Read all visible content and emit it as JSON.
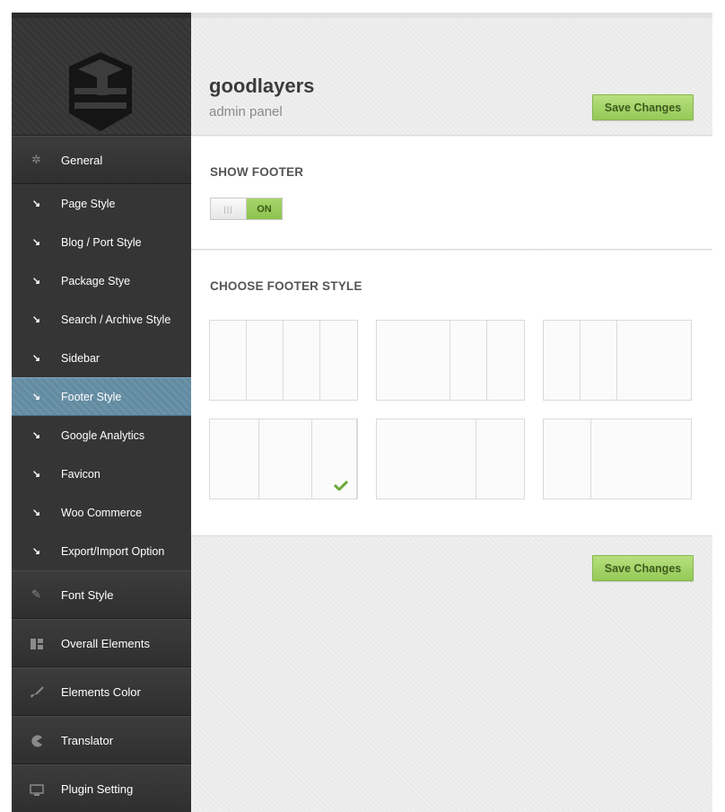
{
  "app": {
    "title": "goodlayers",
    "subtitle": "admin panel"
  },
  "buttons": {
    "save_top": "Save Changes",
    "save_bottom": "Save Changes"
  },
  "sidebar": {
    "general": {
      "label": "General",
      "icon": "gear-icon"
    },
    "sub_items": [
      {
        "label": "Page Style",
        "active": false
      },
      {
        "label": "Blog / Port Style",
        "active": false
      },
      {
        "label": "Package Stye",
        "active": false
      },
      {
        "label": "Search / Archive Style",
        "active": false
      },
      {
        "label": "Sidebar",
        "active": false
      },
      {
        "label": "Footer Style",
        "active": true
      },
      {
        "label": "Google Analytics",
        "active": false
      },
      {
        "label": "Favicon",
        "active": false
      },
      {
        "label": "Woo Commerce",
        "active": false
      },
      {
        "label": "Export/Import Option",
        "active": false
      }
    ],
    "sections": [
      {
        "label": "Font Style",
        "icon": "pencil-icon"
      },
      {
        "label": "Overall Elements",
        "icon": "layout-icon"
      },
      {
        "label": "Elements Color",
        "icon": "brush-icon"
      },
      {
        "label": "Translator",
        "icon": "pacman-icon"
      },
      {
        "label": "Plugin Setting",
        "icon": "monitor-icon"
      }
    ]
  },
  "show_footer": {
    "label": "SHOW FOOTER",
    "toggle_knob": "|||",
    "toggle_state": "ON"
  },
  "footer_style": {
    "label": "CHOOSE FOOTER STYLE",
    "selected_index": 3,
    "options": [
      {
        "name": "4 equal columns"
      },
      {
        "name": "half + 2 quarters"
      },
      {
        "name": "2 quarters + half"
      },
      {
        "name": "3 equal columns"
      },
      {
        "name": "two-thirds + third"
      },
      {
        "name": "third + two-thirds"
      }
    ]
  },
  "colors": {
    "accent_green": "#9ccd5f",
    "active_blue": "#6a93a8",
    "sidebar_dark": "#333333"
  }
}
